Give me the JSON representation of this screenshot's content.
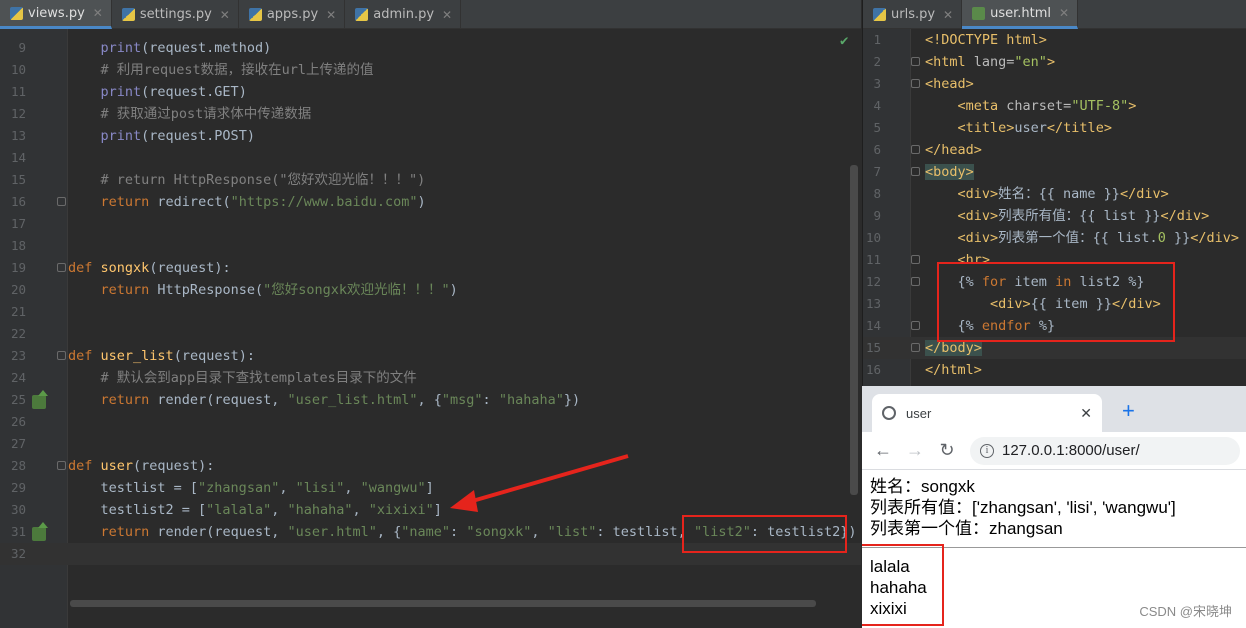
{
  "left_editor": {
    "tabs": [
      {
        "label": "views.py",
        "active": true
      },
      {
        "label": "settings.py",
        "active": false
      },
      {
        "label": "apps.py",
        "active": false
      },
      {
        "label": "admin.py",
        "active": false
      }
    ],
    "lines": [
      {
        "n": "9",
        "tokens": [
          [
            "    ",
            ""
          ],
          [
            "print",
            "bi"
          ],
          [
            "(request.method)",
            ""
          ]
        ]
      },
      {
        "n": "10",
        "tokens": [
          [
            "    # 利用request数据，接收在url上传递的值",
            "cm"
          ]
        ]
      },
      {
        "n": "11",
        "tokens": [
          [
            "    ",
            ""
          ],
          [
            "print",
            "bi"
          ],
          [
            "(request.GET)",
            ""
          ]
        ]
      },
      {
        "n": "12",
        "tokens": [
          [
            "    # 获取通过post请求体中传递数据",
            "cm"
          ]
        ]
      },
      {
        "n": "13",
        "tokens": [
          [
            "    ",
            ""
          ],
          [
            "print",
            "bi"
          ],
          [
            "(request.POST)",
            ""
          ]
        ]
      },
      {
        "n": "14",
        "tokens": []
      },
      {
        "n": "15",
        "tokens": [
          [
            "    # return HttpResponse(\"您好欢迎光临！！！\")",
            "cm"
          ]
        ]
      },
      {
        "n": "16",
        "tokens": [
          [
            "    ",
            ""
          ],
          [
            "return",
            "kw"
          ],
          [
            " redirect(",
            ""
          ],
          [
            "\"https://www.baidu.com\"",
            "str"
          ],
          [
            ")",
            ""
          ]
        ]
      },
      {
        "n": "17",
        "tokens": []
      },
      {
        "n": "18",
        "tokens": []
      },
      {
        "n": "19",
        "tokens": [
          [
            "def",
            "kw"
          ],
          [
            " ",
            ""
          ],
          [
            "songxk",
            "fn"
          ],
          [
            "(request):",
            ""
          ]
        ]
      },
      {
        "n": "20",
        "tokens": [
          [
            "    ",
            ""
          ],
          [
            "return",
            "kw"
          ],
          [
            " HttpResponse(",
            ""
          ],
          [
            "\"您好songxk欢迎光临！！！\"",
            "str"
          ],
          [
            ")",
            ""
          ]
        ]
      },
      {
        "n": "21",
        "tokens": []
      },
      {
        "n": "22",
        "tokens": []
      },
      {
        "n": "23",
        "tokens": [
          [
            "def",
            "kw"
          ],
          [
            " ",
            ""
          ],
          [
            "user_list",
            "fn"
          ],
          [
            "(request):",
            ""
          ]
        ]
      },
      {
        "n": "24",
        "tokens": [
          [
            "    # 默认会到app目录下查找templates目录下的文件",
            "cm"
          ]
        ]
      },
      {
        "n": "25",
        "tokens": [
          [
            "    ",
            ""
          ],
          [
            "return",
            "kw"
          ],
          [
            " render(request, ",
            ""
          ],
          [
            "\"user_list.html\"",
            "str"
          ],
          [
            ", {",
            ""
          ],
          [
            "\"msg\"",
            "str"
          ],
          [
            ": ",
            ""
          ],
          [
            "\"hahaha\"",
            "str"
          ],
          [
            "})",
            ""
          ]
        ]
      },
      {
        "n": "26",
        "tokens": []
      },
      {
        "n": "27",
        "tokens": []
      },
      {
        "n": "28",
        "tokens": [
          [
            "def",
            "kw"
          ],
          [
            " ",
            ""
          ],
          [
            "user",
            "fn"
          ],
          [
            "(request):",
            ""
          ]
        ]
      },
      {
        "n": "29",
        "tokens": [
          [
            "    testlist = [",
            ""
          ],
          [
            "\"zhangsan\"",
            "str"
          ],
          [
            ", ",
            ""
          ],
          [
            "\"lisi\"",
            "str"
          ],
          [
            ", ",
            ""
          ],
          [
            "\"wangwu\"",
            "str"
          ],
          [
            "]",
            ""
          ]
        ]
      },
      {
        "n": "30",
        "tokens": [
          [
            "    testlist2 = [",
            ""
          ],
          [
            "\"lalala\"",
            "str"
          ],
          [
            ", ",
            ""
          ],
          [
            "\"hahaha\"",
            "str"
          ],
          [
            ", ",
            ""
          ],
          [
            "\"xixixi\"",
            "str"
          ],
          [
            "]",
            ""
          ]
        ]
      },
      {
        "n": "31",
        "tokens": [
          [
            "    ",
            ""
          ],
          [
            "return",
            "kw"
          ],
          [
            " render(request, ",
            ""
          ],
          [
            "\"user.html\"",
            "str"
          ],
          [
            ", {",
            ""
          ],
          [
            "\"name\"",
            "str"
          ],
          [
            ": ",
            ""
          ],
          [
            "\"songxk\"",
            "str"
          ],
          [
            ", ",
            ""
          ],
          [
            "\"list\"",
            "str"
          ],
          [
            ": testlist, ",
            ""
          ],
          [
            "\"list2\"",
            "str"
          ],
          [
            ": testlist2})",
            ""
          ]
        ]
      },
      {
        "n": "32",
        "tokens": []
      }
    ]
  },
  "right_editor": {
    "tabs": [
      {
        "label": "urls.py",
        "active": false
      },
      {
        "label": "user.html",
        "active": true
      }
    ],
    "lines": [
      {
        "n": "1",
        "tokens": [
          [
            "<!DOCTYPE html>",
            "tag"
          ]
        ]
      },
      {
        "n": "2",
        "tokens": [
          [
            "<html ",
            "tag"
          ],
          [
            "lang=",
            "attr"
          ],
          [
            "\"en\"",
            "astr"
          ],
          [
            ">",
            "tag"
          ]
        ]
      },
      {
        "n": "3",
        "tokens": [
          [
            "<head>",
            "tag"
          ]
        ]
      },
      {
        "n": "4",
        "tokens": [
          [
            "    <meta ",
            "tag"
          ],
          [
            "charset=",
            "attr"
          ],
          [
            "\"UTF-8\"",
            "astr"
          ],
          [
            ">",
            "tag"
          ]
        ]
      },
      {
        "n": "5",
        "tokens": [
          [
            "    <title>",
            "tag"
          ],
          [
            "user",
            ""
          ],
          [
            "</title>",
            "tag"
          ]
        ]
      },
      {
        "n": "6",
        "tokens": [
          [
            "</head>",
            "tag"
          ]
        ]
      },
      {
        "n": "7",
        "tokens": [
          [
            "<body>",
            "tag hl-body"
          ]
        ]
      },
      {
        "n": "8",
        "tokens": [
          [
            "    <div>",
            "tag"
          ],
          [
            "姓名：{{ name }}",
            ""
          ],
          [
            "</div>",
            "tag"
          ]
        ]
      },
      {
        "n": "9",
        "tokens": [
          [
            "    <div>",
            "tag"
          ],
          [
            "列表所有值：{{ list }}",
            ""
          ],
          [
            "</div>",
            "tag"
          ]
        ]
      },
      {
        "n": "10",
        "tokens": [
          [
            "    <div>",
            "tag"
          ],
          [
            "列表第一个值：{{ list.",
            ""
          ],
          [
            "0",
            "astr"
          ],
          [
            " }}",
            ""
          ],
          [
            "</div>",
            "tag"
          ]
        ]
      },
      {
        "n": "11",
        "tokens": [
          [
            "    <hr>",
            "tag"
          ]
        ]
      },
      {
        "n": "12",
        "tokens": [
          [
            "    {% ",
            ""
          ],
          [
            "for",
            "tplkw"
          ],
          [
            " item ",
            ""
          ],
          [
            "in",
            "tplkw"
          ],
          [
            " list2 %}",
            ""
          ]
        ]
      },
      {
        "n": "13",
        "tokens": [
          [
            "        <div>",
            "tag"
          ],
          [
            "{{ item }}",
            ""
          ],
          [
            "</div>",
            "tag"
          ]
        ]
      },
      {
        "n": "14",
        "tokens": [
          [
            "    {% ",
            ""
          ],
          [
            "endfor",
            "tplkw"
          ],
          [
            " %}",
            ""
          ]
        ]
      },
      {
        "n": "15",
        "tokens": [
          [
            "</body>",
            "tag hl-body"
          ]
        ]
      },
      {
        "n": "16",
        "tokens": [
          [
            "</html>",
            "tag"
          ]
        ]
      }
    ]
  },
  "browser": {
    "tab_title": "user",
    "new_tab": "+",
    "url": "127.0.0.1:8000/user/",
    "page_lines": [
      "姓名：songxk",
      "列表所有值：['zhangsan', 'lisi', 'wangwu']",
      "列表第一个值：zhangsan"
    ],
    "loop_items": [
      "lalala",
      "hahaha",
      "xixixi"
    ]
  },
  "watermark": "CSDN @宋晓坤",
  "colors": {
    "annotation_red": "#e5241c",
    "editor_bg": "#2b2b2b",
    "keyword": "#cc7832",
    "string": "#6a8759"
  }
}
